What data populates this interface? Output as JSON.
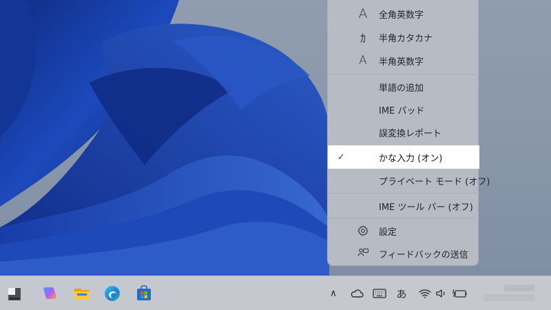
{
  "ime_menu": {
    "items": [
      {
        "label": "全角英数字",
        "icon": "font-a-icon"
      },
      {
        "label": "半角カタカナ",
        "icon": "katakana-icon"
      },
      {
        "label": "半角英数字",
        "icon": "font-a-icon"
      },
      {
        "label": "単語の追加",
        "icon": ""
      },
      {
        "label": "IME パッド",
        "icon": ""
      },
      {
        "label": "誤変換レポート",
        "icon": ""
      },
      {
        "label": "かな入力 (オン)",
        "icon": "",
        "checked": true
      },
      {
        "label": "プライベート モード (オフ)",
        "icon": ""
      },
      {
        "label": "IME ツール バー (オフ)",
        "icon": ""
      },
      {
        "label": "設定",
        "icon": "gear-icon"
      },
      {
        "label": "フィードバックの送信",
        "icon": "feedback-icon"
      }
    ],
    "check_mark": "✓",
    "font_a_glyph": "A",
    "katakana_glyph": "ｶ"
  },
  "taskbar": {
    "apps": [
      "start-icon",
      "copilot-icon",
      "file-explorer-icon",
      "edge-icon",
      "store-icon"
    ],
    "tray": {
      "chevron": "∧",
      "ime_mode": "あ"
    }
  },
  "colors": {
    "menu_bg": "#b7bcc4",
    "selected_bg": "#ffffff",
    "taskbar_bg": "#c5c9cf",
    "wallpaper_blue": "#1e4fd8"
  }
}
